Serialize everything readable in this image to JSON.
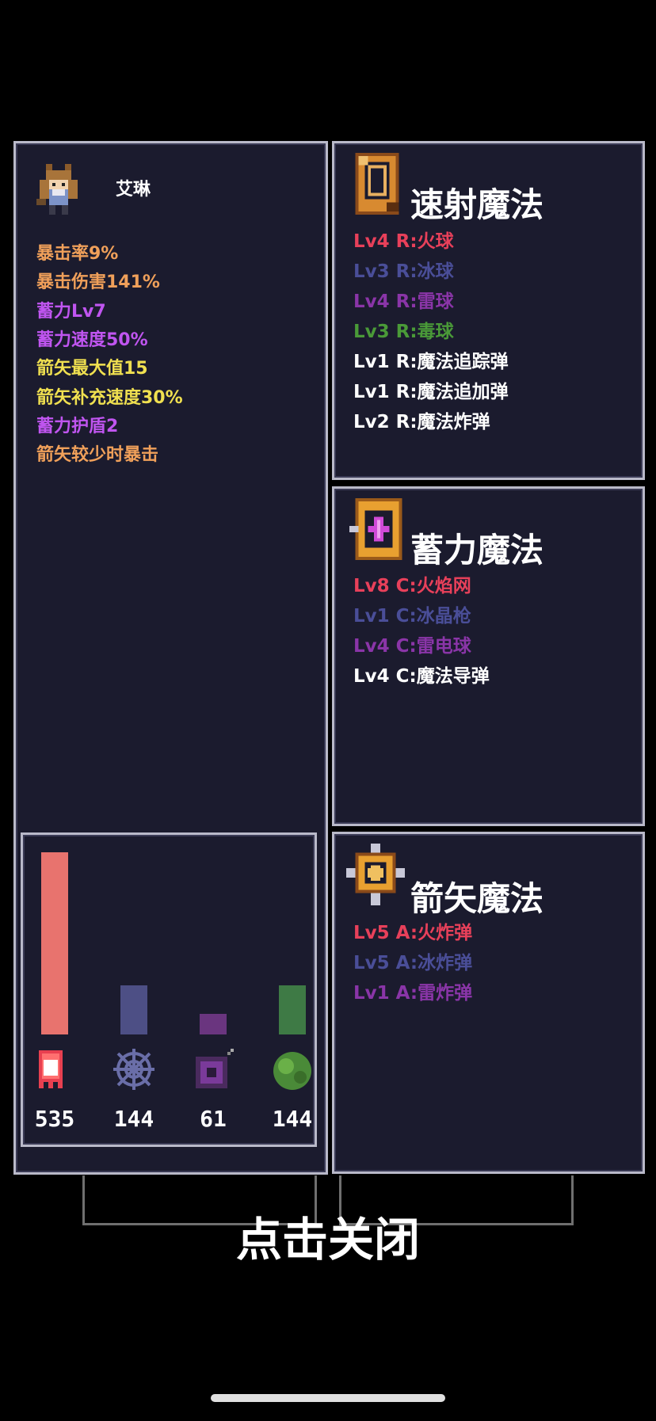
{
  "colors": {
    "orange": "#f0a05a",
    "violet": "#c055f0",
    "yellow": "#f0e050",
    "fire": "#e8405a",
    "ice": "#4a4e98",
    "thunder": "#8a35a8",
    "poison": "#4a9a38",
    "white": "#ffffff"
  },
  "character": {
    "name": "艾琳",
    "stats": [
      {
        "text": "暴击率9%",
        "color": "orange"
      },
      {
        "text": "暴击伤害141%",
        "color": "orange"
      },
      {
        "text": "蓄力Lv7",
        "color": "violet"
      },
      {
        "text": "蓄力速度50%",
        "color": "violet"
      },
      {
        "text": "箭矢最大值15",
        "color": "yellow"
      },
      {
        "text": "箭矢补充速度30%",
        "color": "yellow"
      },
      {
        "text": "蓄力护盾2",
        "color": "violet"
      },
      {
        "text": "箭矢较少时暴击",
        "color": "orange"
      }
    ]
  },
  "damage": {
    "max": 535,
    "items": [
      {
        "icon": "fire-ghost-icon",
        "value": 535,
        "label": "535",
        "color": "#e8736e"
      },
      {
        "icon": "ice-web-icon",
        "value": 144,
        "label": "144",
        "color": "#4d4f85"
      },
      {
        "icon": "thunder-orb-icon",
        "value": 61,
        "label": "61",
        "color": "#6a357f"
      },
      {
        "icon": "poison-blob-icon",
        "value": 144,
        "label": "144",
        "color": "#3e7a45"
      }
    ]
  },
  "rapid": {
    "title": "速射魔法",
    "icon": "rapid-magic-icon",
    "lines": [
      {
        "text": "Lv4 R:火球",
        "color": "fire"
      },
      {
        "text": "Lv3 R:冰球",
        "color": "ice"
      },
      {
        "text": "Lv4 R:雷球",
        "color": "thunder"
      },
      {
        "text": "Lv3 R:毒球",
        "color": "poison"
      },
      {
        "text": "Lv1 R:魔法追踪弹",
        "color": "white"
      },
      {
        "text": "Lv1 R:魔法追加弹",
        "color": "white"
      },
      {
        "text": "Lv2 R:魔法炸弹",
        "color": "white"
      }
    ]
  },
  "charge": {
    "title": "蓄力魔法",
    "icon": "charge-magic-icon",
    "lines": [
      {
        "text": "Lv8 C:火焰网",
        "color": "fire"
      },
      {
        "text": "Lv1 C:冰晶枪",
        "color": "ice"
      },
      {
        "text": "Lv4 C:雷电球",
        "color": "thunder"
      },
      {
        "text": "Lv4 C:魔法导弹",
        "color": "white"
      }
    ]
  },
  "arrow": {
    "title": "箭矢魔法",
    "icon": "arrow-magic-icon",
    "lines": [
      {
        "text": "Lv5 A:火炸弹",
        "color": "fire"
      },
      {
        "text": "Lv5 A:冰炸弹",
        "color": "ice"
      },
      {
        "text": "Lv1 A:雷炸弹",
        "color": "thunder"
      }
    ]
  },
  "close_label": "点击关闭"
}
